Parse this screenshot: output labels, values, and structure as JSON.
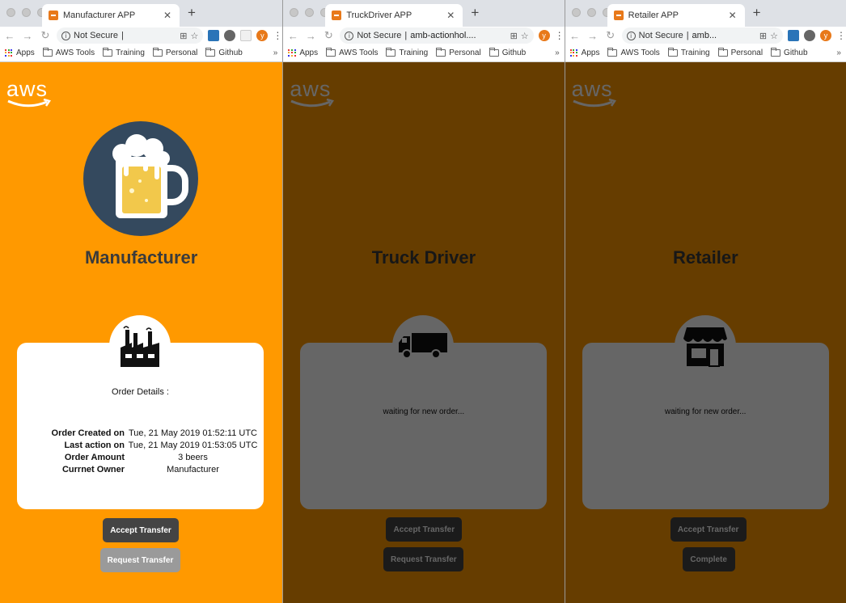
{
  "chrome": {
    "not_secure": "Not Secure",
    "bookmarks": [
      "Apps",
      "AWS Tools",
      "Training",
      "Personal",
      "Github"
    ],
    "more": "»",
    "avatar_letter": "y"
  },
  "windows": [
    {
      "tab_title": "Manufacturer APP",
      "url": "",
      "role": "Manufacturer",
      "card": {
        "heading": "Order Details :",
        "rows": [
          {
            "label": "Order Created on",
            "value": "Tue, 21 May 2019 01:52:11 UTC"
          },
          {
            "label": "Last action on",
            "value": "Tue, 21 May 2019 01:53:05 UTC"
          },
          {
            "label": "Order Amount",
            "value": "3 beers"
          },
          {
            "label": "Currnet Owner",
            "value": "Manufacturer"
          }
        ]
      },
      "buttons": [
        "Accept Transfer",
        "Request Transfer"
      ]
    },
    {
      "tab_title": "TruckDriver APP",
      "url": "amb-actionhol....",
      "role": "Truck Driver",
      "waiting": "waiting for new order...",
      "buttons": [
        "Accept Transfer",
        "Request Transfer"
      ]
    },
    {
      "tab_title": "Retailer APP",
      "url": "amb...",
      "role": "Retailer",
      "waiting": "waiting for new order...",
      "buttons": [
        "Accept Transfer",
        "Complete"
      ]
    }
  ],
  "logo_text": "aws",
  "colors": {
    "page_bg": "#ff9900",
    "hero_circle": "#34495e",
    "dark_button": "#444444",
    "tab_favicon": "#e8791a"
  }
}
